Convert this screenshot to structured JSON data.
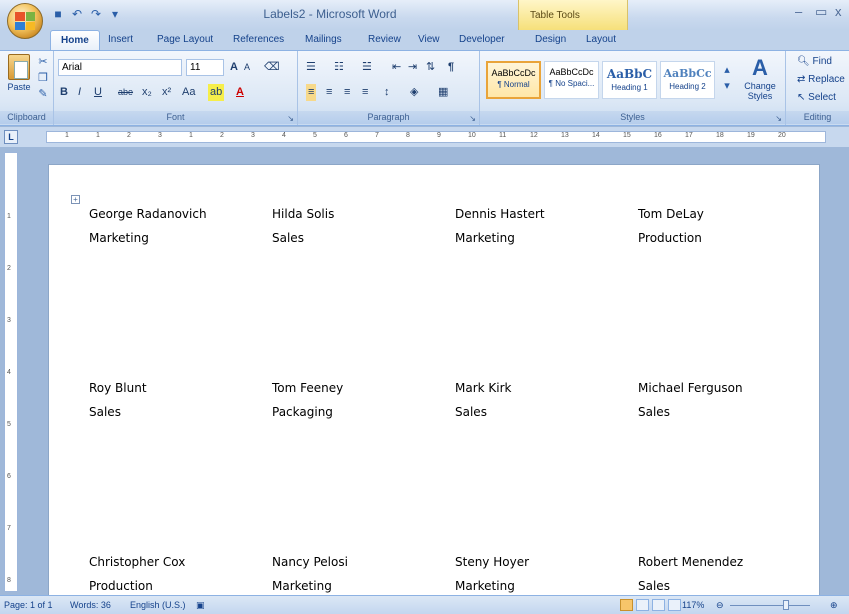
{
  "window": {
    "title": "Labels2 - Microsoft Word",
    "table_tools": "Table Tools",
    "minimize": "–",
    "maximize": "▭",
    "close": "x"
  },
  "tabs": [
    {
      "label": "Home",
      "active": true
    },
    {
      "label": "Insert"
    },
    {
      "label": "Page Layout"
    },
    {
      "label": "References"
    },
    {
      "label": "Mailings"
    },
    {
      "label": "Review"
    },
    {
      "label": "View"
    },
    {
      "label": "Developer"
    },
    {
      "label": "Design"
    },
    {
      "label": "Layout"
    }
  ],
  "ribbon": {
    "clipboard": {
      "paste": "Paste",
      "group": "Clipboard"
    },
    "font": {
      "name": "Arial",
      "size": "11",
      "group": "Font",
      "bold": "B",
      "italic": "I",
      "underline": "U",
      "strike": "abe",
      "sub": "x₂",
      "sup": "x²",
      "case": "Aa",
      "grow": "A",
      "shrink": "A"
    },
    "paragraph": {
      "group": "Paragraph",
      "pilcrow": "¶"
    },
    "styles": {
      "group": "Styles",
      "items": [
        {
          "preview": "AaBbCcDc",
          "name": "¶ Normal"
        },
        {
          "preview": "AaBbCcDc",
          "name": "¶ No Spaci..."
        },
        {
          "preview": "AaBbC",
          "name": "Heading 1"
        },
        {
          "preview": "AaBbCc",
          "name": "Heading 2"
        }
      ],
      "change": "Change Styles"
    },
    "editing": {
      "find": "Find",
      "replace": "Replace",
      "select": "Select",
      "group": "Editing"
    }
  },
  "ruler": {
    "corner": "L",
    "numbers": [
      "1",
      "1",
      "2",
      "3",
      "1",
      "2",
      "3",
      "4",
      "5",
      "6",
      "7",
      "8",
      "9",
      "10",
      "11",
      "12",
      "13",
      "14",
      "15",
      "16",
      "17",
      "18",
      "19",
      "20"
    ]
  },
  "vruler": {
    "numbers": [
      "1",
      "2",
      "3",
      "4",
      "5",
      "6",
      "7",
      "8"
    ]
  },
  "labels": [
    {
      "name": "George Radanovich",
      "dept": "Marketing"
    },
    {
      "name": "Hilda Solis",
      "dept": "Sales"
    },
    {
      "name": "Dennis Hastert",
      "dept": "Marketing"
    },
    {
      "name": "Tom DeLay",
      "dept": "Production"
    },
    {
      "name": "Roy Blunt",
      "dept": "Sales"
    },
    {
      "name": "Tom Feeney",
      "dept": "Packaging"
    },
    {
      "name": "Mark Kirk",
      "dept": "Sales"
    },
    {
      "name": "Michael Ferguson",
      "dept": "Sales"
    },
    {
      "name": "Christopher Cox",
      "dept": "Production"
    },
    {
      "name": "Nancy Pelosi",
      "dept": "Marketing"
    },
    {
      "name": "Steny Hoyer",
      "dept": "Marketing"
    },
    {
      "name": "Robert Menendez",
      "dept": "Sales"
    }
  ],
  "status": {
    "page": "Page: 1 of 1",
    "words": "Words: 36",
    "language": "English (U.S.)",
    "zoom": "117%"
  }
}
